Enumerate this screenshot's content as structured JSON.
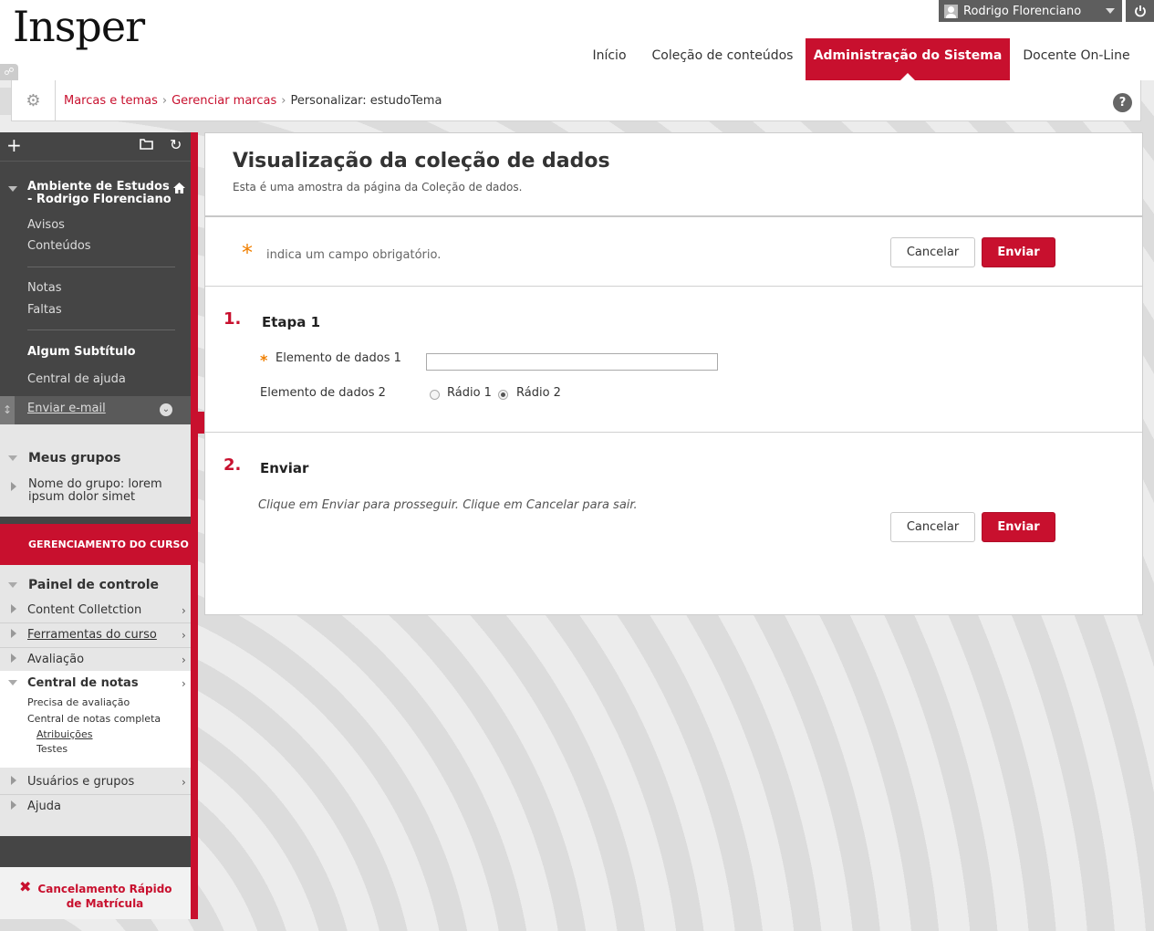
{
  "header": {
    "logo": "Insper",
    "user_name": "Rodrigo Florenciano",
    "tabs": [
      "Início",
      "Coleção de conteúdos",
      "Administração do Sistema",
      "Docente On-Line"
    ],
    "active_tab": "Administração do Sistema"
  },
  "breadcrumb": {
    "items": [
      "Marcas e temas",
      "Gerenciar marcas"
    ],
    "current": "Personalizar: estudoTema",
    "help": "?"
  },
  "sidebar": {
    "course_title": "Ambiente de Estudos - Rodrigo Florenciano",
    "links": [
      "Avisos",
      "Conteúdos",
      "Notas",
      "Faltas"
    ],
    "subtitle": "Algum Subtítulo",
    "help_center": "Central de ajuda",
    "email": "Enviar e-mail",
    "groups_title": "Meus grupos",
    "group_name": "Nome do grupo: lorem ipsum dolor simet",
    "management_title": "GERENCIAMENTO DO CURSO",
    "control_panel": "Painel de controle",
    "panel_items": [
      "Content Colletction",
      "Ferramentas do curso",
      "Avaliação",
      "Central de notas"
    ],
    "gradebook_sub": [
      "Precisa de avaliação",
      "Central de notas completa",
      "Atribuições",
      "Testes"
    ],
    "panel_items_after": [
      "Usuários e grupos",
      "Ajuda"
    ],
    "quick_unenroll": "Cancelamento Rápido de Matrícula"
  },
  "content": {
    "title": "Visualização da coleção de dados",
    "subtitle": "Esta é uma amostra da página da Coleção de dados.",
    "required_note": "indica um campo obrigatório.",
    "required_mark": "*",
    "cancel": "Cancelar",
    "submit": "Enviar",
    "step1_num": "1.",
    "step1_title": "Etapa 1",
    "field1_label": "Elemento de dados 1",
    "field2_label": "Elemento de dados 2",
    "radio1": "Rádio 1",
    "radio2": "Rádio 2",
    "radio_selected": "Rádio 2",
    "step2_num": "2.",
    "step2_title": "Enviar",
    "step2_text": "Clique em Enviar para prosseguir. Clique em Cancelar para sair."
  },
  "colors": {
    "accent": "#c8102e",
    "sidebar_dark": "#454545"
  }
}
